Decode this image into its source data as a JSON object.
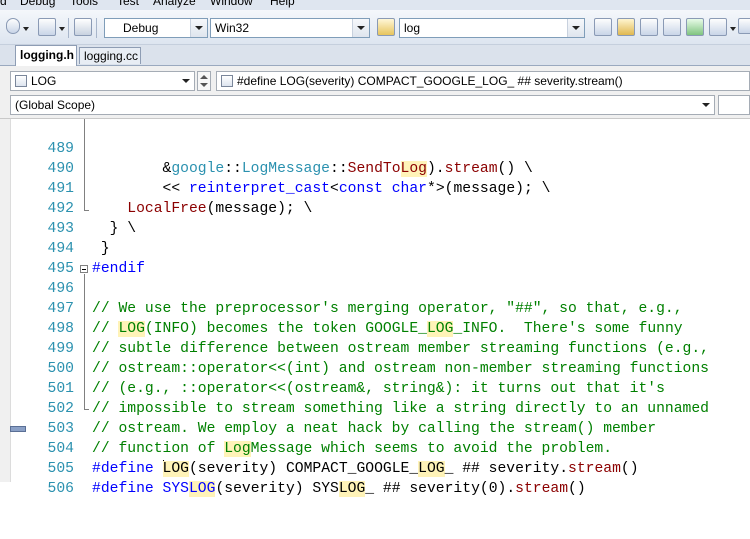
{
  "menu": [
    "Debug",
    "Tools",
    "Test",
    "Analyze",
    "Window",
    "Help"
  ],
  "toolbar": {
    "configuration": "Debug",
    "platform": "Win32",
    "find_value": "log"
  },
  "tabs": [
    {
      "label": "logging.h",
      "active": true
    },
    {
      "label": "logging.cc",
      "active": false
    }
  ],
  "nav": {
    "symbol_combo": "LOG",
    "definition_combo": "#define LOG(severity) COMPACT_GOOGLE_LOG_ ## severity.stream()",
    "scope_combo": "(Global Scope)"
  },
  "editor": {
    "colors": {
      "keyword": "#0000ff",
      "type": "#2b91af",
      "comment": "#008000",
      "line_number": "#2b91af",
      "highlight": "#fff3b8"
    },
    "lines": [
      {
        "number": "489"
      },
      {
        "number": "490"
      },
      {
        "number": "491"
      },
      {
        "number": "492"
      },
      {
        "number": "493"
      },
      {
        "number": "494"
      },
      {
        "number": "495"
      },
      {
        "number": "496"
      },
      {
        "number": "497"
      },
      {
        "number": "498"
      },
      {
        "number": "499"
      },
      {
        "number": "500"
      },
      {
        "number": "501"
      },
      {
        "number": "502"
      },
      {
        "number": "503"
      },
      {
        "number": "504"
      },
      {
        "number": "505"
      },
      {
        "number": "506"
      }
    ]
  }
}
